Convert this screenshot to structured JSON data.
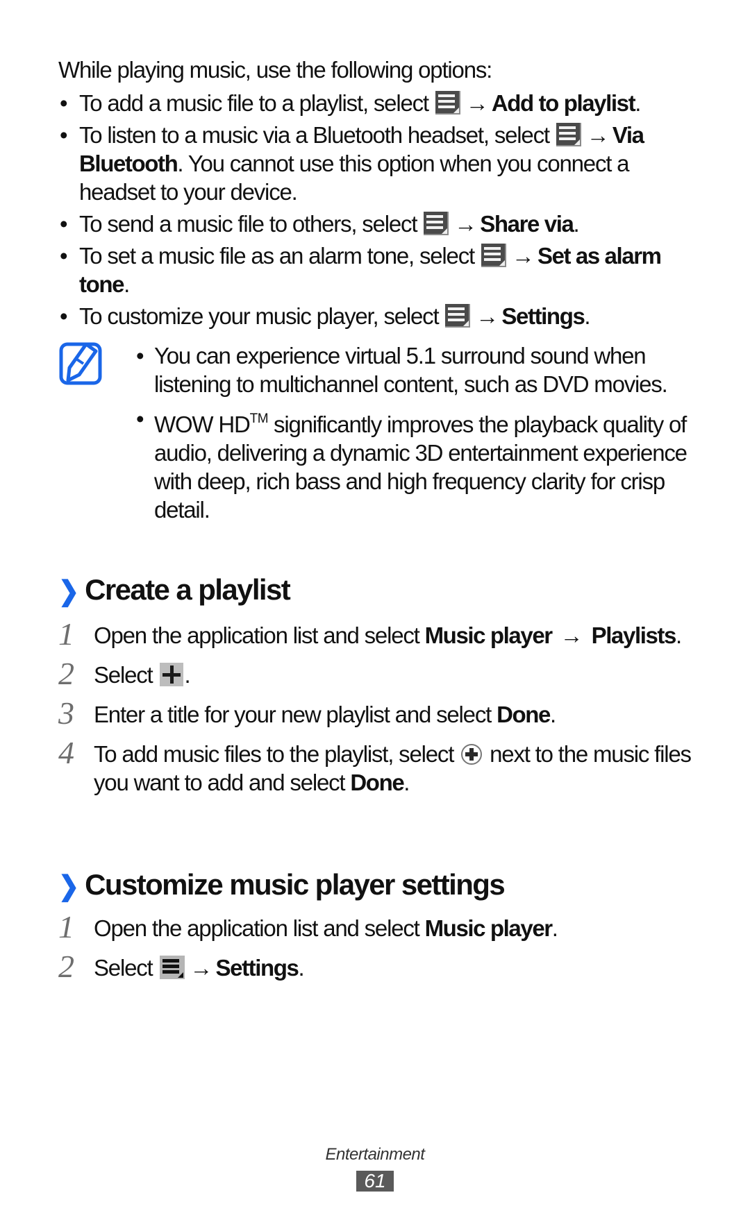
{
  "intro": "While playing music, use the following options:",
  "options": [
    {
      "pre": "To add a music file to a playlist, select",
      "icon": "menu-icon",
      "arrow": "→",
      "bold": "Add to playlist",
      "post": "."
    },
    {
      "pre": "To listen to a music via a Bluetooth headset, select",
      "icon": "menu-icon",
      "arrow": "→",
      "bold": "Via Bluetooth",
      "post": ". You cannot use this option when you connect a headset to your device."
    },
    {
      "pre": "To send a music file to others, select",
      "icon": "menu-icon",
      "arrow": "→",
      "bold": "Share via",
      "post": "."
    },
    {
      "pre": "To set a music file as an alarm tone, select",
      "icon": "menu-icon",
      "arrow": "→",
      "bold": "Set as alarm tone",
      "post": "."
    },
    {
      "pre": "To customize your music player, select",
      "icon": "menu-icon",
      "arrow": "→",
      "bold": "Settings",
      "post": "."
    }
  ],
  "note": {
    "icon": "note-pencil-icon",
    "accent_color": "#1a66e8",
    "items": [
      {
        "text": "You can experience virtual 5.1 surround sound when listening to multichannel content, such as DVD movies."
      },
      {
        "pre": "WOW HD",
        "tm": "TM",
        "post": " significantly improves the playback quality of audio, delivering a dynamic 3D entertainment experience with deep, rich bass and high frequency clarity for crisp detail."
      }
    ]
  },
  "sections": [
    {
      "chevron": "❯",
      "title": "Create a playlist",
      "steps": [
        {
          "num": "1",
          "pre": "Open the application list and select",
          "bold1": "Music player",
          "arrow": "→",
          "bold2": "Playlists",
          "post": "."
        },
        {
          "num": "2",
          "pre": "Select",
          "icon": "add-icon",
          "post": "."
        },
        {
          "num": "3",
          "pre": "Enter a title for your new playlist and select",
          "bold": "Done",
          "post": "."
        },
        {
          "num": "4",
          "pre": "To add music files to the playlist, select",
          "icon": "add-circle-icon",
          "mid": "next to the music files you want to add and select",
          "bold": "Done",
          "post": "."
        }
      ]
    },
    {
      "chevron": "❯",
      "title": "Customize music player settings",
      "steps": [
        {
          "num": "1",
          "pre": "Open the application list and select",
          "bold": "Music player",
          "post": "."
        },
        {
          "num": "2",
          "pre": "Select",
          "icon": "menu-icon",
          "arrow": "→",
          "bold": "Settings",
          "post": "."
        }
      ]
    }
  ],
  "footer": {
    "chapter": "Entertainment",
    "page": "61"
  }
}
